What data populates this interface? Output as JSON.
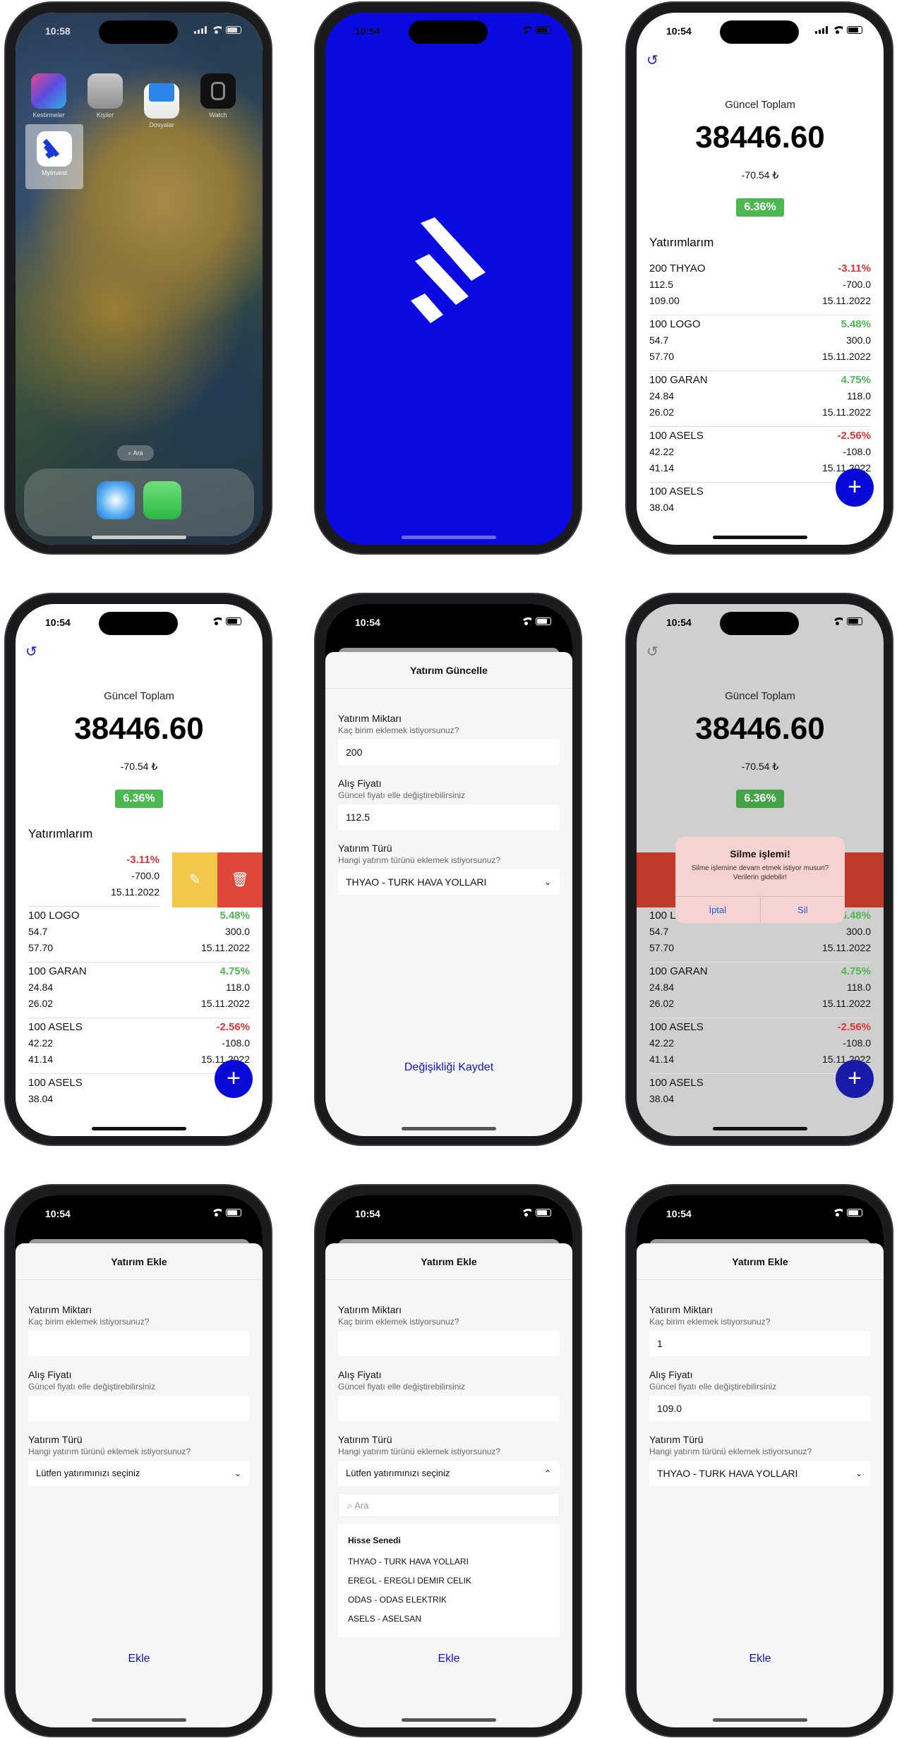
{
  "home": {
    "time": "10:58",
    "apps": [
      "Kestirmeler",
      "Kişiler",
      "Dosyalar",
      "Watch"
    ],
    "myinvest_label": "MyInvest",
    "search_pill": "Ara"
  },
  "status_time": "10:54",
  "portfolio": {
    "title": "Güncel Toplam",
    "total": "38446.60",
    "delta": "-70.54 ₺",
    "percent": "6.36%",
    "section": "Yatırımlarım",
    "items": [
      {
        "name": "200 THYAO",
        "pct": "-3.11%",
        "price": "112.5",
        "pl": "-700.0",
        "current": "109.00",
        "date": "15.11.2022",
        "trend": "neg"
      },
      {
        "name": "100 LOGO",
        "pct": "5.48%",
        "price": "54.7",
        "pl": "300.0",
        "current": "57.70",
        "date": "15.11.2022",
        "trend": "pos"
      },
      {
        "name": "100 GARAN",
        "pct": "4.75%",
        "price": "24.84",
        "pl": "118.0",
        "current": "26.02",
        "date": "15.11.2022",
        "trend": "pos"
      },
      {
        "name": "100 ASELS",
        "pct": "-2.56%",
        "price": "42.22",
        "pl": "-108.0",
        "current": "41.14",
        "date": "15.11.2022",
        "trend": "neg"
      },
      {
        "name": "100 ASELS",
        "pct": "",
        "price": "38.04",
        "pl": "",
        "current": "",
        "date": "",
        "trend": "neg"
      }
    ],
    "add_label": "+"
  },
  "alert": {
    "title": "Silme işlemi!",
    "message": "Silme işlemine devam etmek istiyor musun? Verilerin gidebilir!",
    "cancel": "İptal",
    "delete": "Sil"
  },
  "update_form": {
    "header": "Yatırım Güncelle",
    "qty_label": "Yatırım Miktarı",
    "qty_hint": "Kaç birim eklemek istiyorsunuz?",
    "qty_value": "200",
    "price_label": "Alış Fiyatı",
    "price_hint": "Güncel fiyatı elle değiştirebilirsiniz",
    "price_value": "112.5",
    "type_label": "Yatırım Türü",
    "type_hint": "Hangi yatırım türünü eklemek istiyorsunuz?",
    "type_value": "THYAO - TURK HAVA YOLLARI",
    "submit": "Değişikliği Kaydet"
  },
  "add_form": {
    "header": "Yatırım Ekle",
    "qty_label": "Yatırım Miktarı",
    "qty_hint": "Kaç birim eklemek istiyorsunuz?",
    "price_label": "Alış Fiyatı",
    "price_hint": "Güncel fiyatı elle değiştirebilirsiniz",
    "type_label": "Yatırım Türü",
    "type_hint": "Hangi yatırım türünü eklemek istiyorsunuz?",
    "type_placeholder": "Lütfen yatırımınızı seçiniz",
    "search_placeholder": "Ara",
    "group": "Hisse Senedi",
    "options": [
      "THYAO - TURK HAVA YOLLARI",
      "EREGL - EREGLI DEMIR CELIK",
      "ODAS - ODAS ELEKTRIK",
      "ASELS - ASELSAN"
    ],
    "filled_qty": "1",
    "filled_price": "109.0",
    "filled_type": "THYAO - TURK HAVA YOLLARI",
    "submit": "Ekle"
  },
  "colors": {
    "brand_blue": "#0a0ad8",
    "positive": "#4cb850",
    "negative": "#e03636",
    "edit_yellow": "#f2c84b",
    "delete_red": "#e0473b"
  }
}
